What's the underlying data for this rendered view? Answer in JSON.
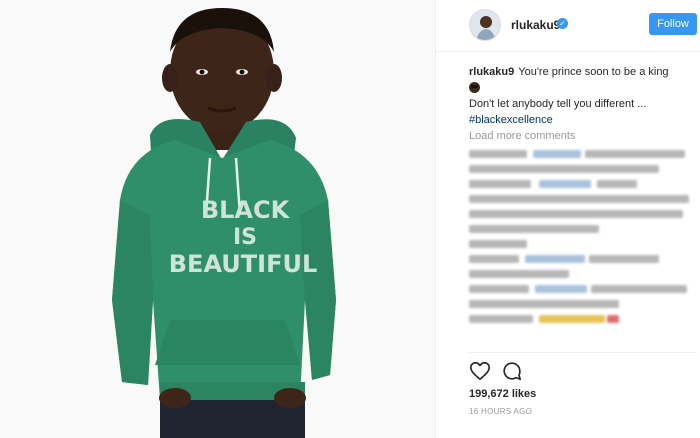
{
  "post": {
    "image_alt": "Child wearing green hoodie",
    "hoodie_text": [
      "BLACK",
      "IS",
      "BEAUTIFUL"
    ]
  },
  "header": {
    "username": "rlukaku9",
    "verified_icon": "verified-check-icon",
    "follow_label": "Follow"
  },
  "caption": {
    "username": "rlukaku9",
    "line1": "You're prince soon to be a king",
    "emoji_icon": "sunglasses-emoji",
    "line2": "Don't let anybody tell you different ...",
    "hashtag": "#blackexcellence"
  },
  "comments": {
    "load_more": "Load more comments"
  },
  "actions": {
    "like_icon": "heart-icon",
    "comment_icon": "comment-bubble-icon"
  },
  "stats": {
    "likes": "199,672 likes",
    "time": "16 HOURS AGO"
  },
  "colors": {
    "accent": "#3897f0",
    "hoodie": "#2f8f6a",
    "hashtag": "#003569"
  }
}
